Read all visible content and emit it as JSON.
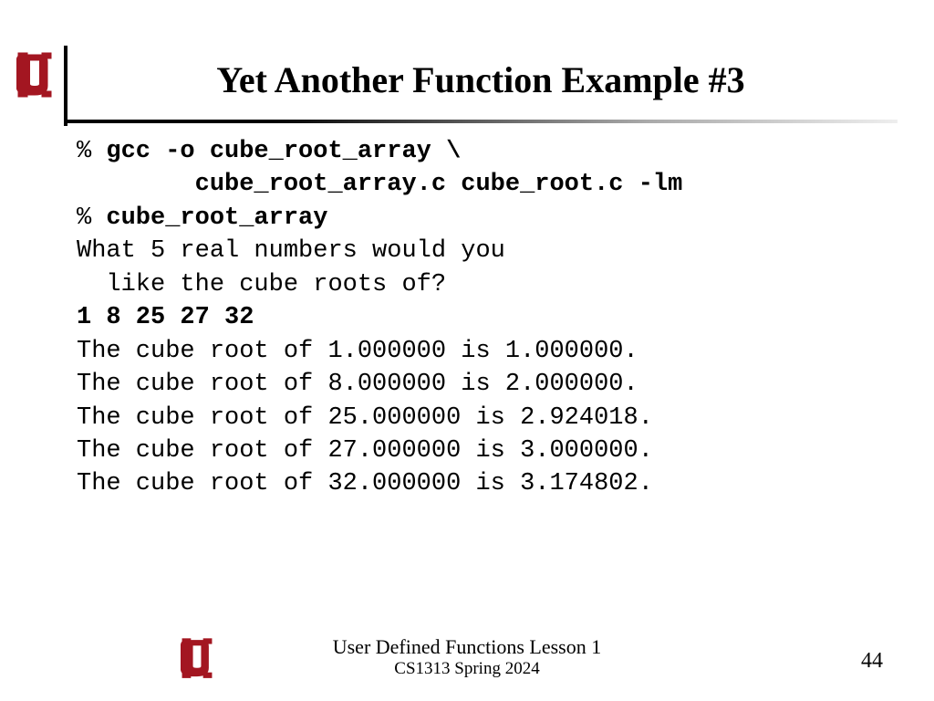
{
  "title": "Yet Another Function Example #3",
  "code": {
    "p1": "% ",
    "c1a": "gcc -o cube_root_array \\",
    "c1b": "        cube_root_array.c cube_root.c -lm",
    "p2": "% ",
    "c2": "cube_root_array",
    "o1": "What 5 real numbers would you",
    "o2": "  like the cube roots of?",
    "in": "1 8 25 27 32",
    "r1": "The cube root of 1.000000 is 1.000000.",
    "r2": "The cube root of 8.000000 is 2.000000.",
    "r3": "The cube root of 25.000000 is 2.924018.",
    "r4": "The cube root of 27.000000 is 3.000000.",
    "r5": "The cube root of 32.000000 is 3.174802."
  },
  "footer": {
    "line1": "User Defined Functions Lesson 1",
    "line2": "CS1313 Spring 2024"
  },
  "page": "44",
  "logo_color": "#a31621"
}
